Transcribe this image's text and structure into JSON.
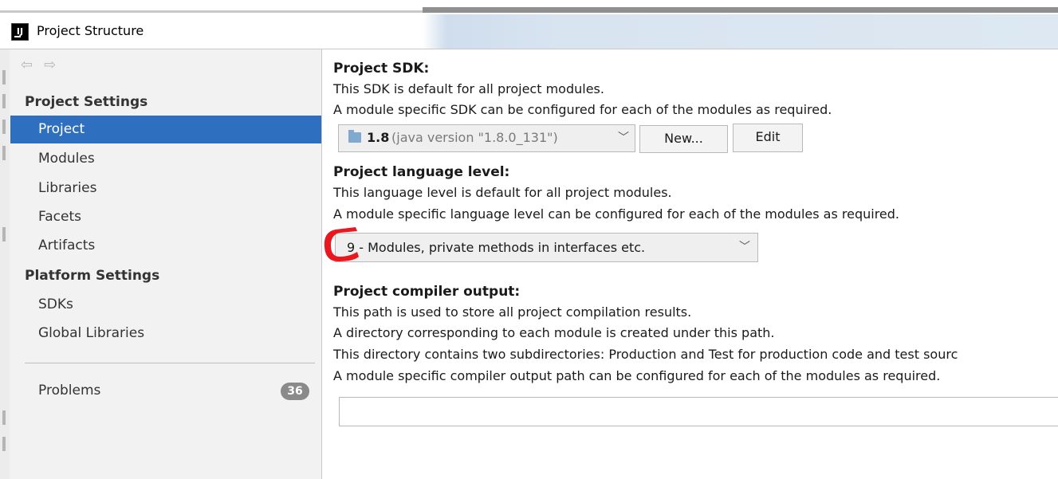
{
  "window": {
    "title": "Project Structure",
    "app_icon_text": "IJ"
  },
  "sidebar": {
    "back_arrow": "⇦",
    "forward_arrow": "⇨",
    "project_settings_header": "Project Settings",
    "project_settings_items": [
      "Project",
      "Modules",
      "Libraries",
      "Facets",
      "Artifacts"
    ],
    "platform_settings_header": "Platform Settings",
    "platform_settings_items": [
      "SDKs",
      "Global Libraries"
    ],
    "problems_label": "Problems",
    "problems_count": "36",
    "selected_item": "Project"
  },
  "sdk": {
    "heading": "Project SDK:",
    "desc1": "This SDK is default for all project modules.",
    "desc2": "A module specific SDK can be configured for each of the modules as required.",
    "selected_version": "1.8",
    "selected_detail": "(java version \"1.8.0_131\")",
    "new_button": "New...",
    "edit_button": "Edit"
  },
  "language": {
    "heading": "Project language level:",
    "desc1": "This language level is default for all project modules.",
    "desc2": "A module specific language level can be configured for each of the modules as required.",
    "selected_value": "9 - Modules, private methods in interfaces etc."
  },
  "compiler": {
    "heading": "Project compiler output:",
    "desc1": "This path is used to store all project compilation results.",
    "desc2": "A directory corresponding to each module is created under this path.",
    "desc3": "This directory contains two subdirectories: Production and Test for production code and test sourc",
    "desc4": "A module specific compiler output path can be configured for each of the modules as required.",
    "output_path": ""
  },
  "colors": {
    "selection": "#2f6fc0",
    "annotation": "#e8181e",
    "badge": "#8a8a8a"
  }
}
